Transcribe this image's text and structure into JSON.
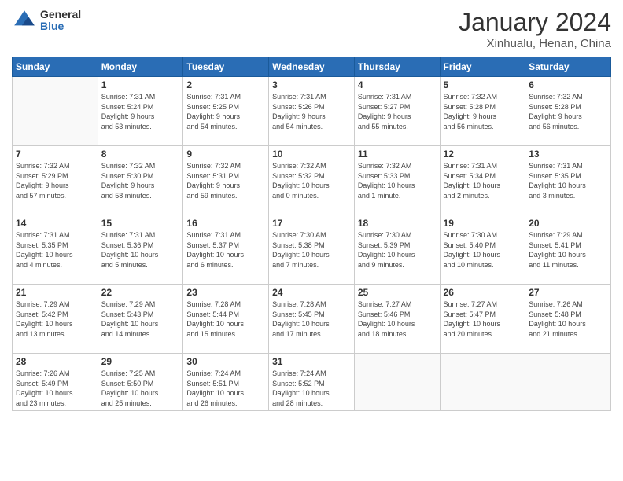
{
  "logo": {
    "general": "General",
    "blue": "Blue"
  },
  "title": "January 2024",
  "subtitle": "Xinhualu, Henan, China",
  "days_header": [
    "Sunday",
    "Monday",
    "Tuesday",
    "Wednesday",
    "Thursday",
    "Friday",
    "Saturday"
  ],
  "weeks": [
    [
      {
        "num": "",
        "info": ""
      },
      {
        "num": "1",
        "info": "Sunrise: 7:31 AM\nSunset: 5:24 PM\nDaylight: 9 hours\nand 53 minutes."
      },
      {
        "num": "2",
        "info": "Sunrise: 7:31 AM\nSunset: 5:25 PM\nDaylight: 9 hours\nand 54 minutes."
      },
      {
        "num": "3",
        "info": "Sunrise: 7:31 AM\nSunset: 5:26 PM\nDaylight: 9 hours\nand 54 minutes."
      },
      {
        "num": "4",
        "info": "Sunrise: 7:31 AM\nSunset: 5:27 PM\nDaylight: 9 hours\nand 55 minutes."
      },
      {
        "num": "5",
        "info": "Sunrise: 7:32 AM\nSunset: 5:28 PM\nDaylight: 9 hours\nand 56 minutes."
      },
      {
        "num": "6",
        "info": "Sunrise: 7:32 AM\nSunset: 5:28 PM\nDaylight: 9 hours\nand 56 minutes."
      }
    ],
    [
      {
        "num": "7",
        "info": "Sunrise: 7:32 AM\nSunset: 5:29 PM\nDaylight: 9 hours\nand 57 minutes."
      },
      {
        "num": "8",
        "info": "Sunrise: 7:32 AM\nSunset: 5:30 PM\nDaylight: 9 hours\nand 58 minutes."
      },
      {
        "num": "9",
        "info": "Sunrise: 7:32 AM\nSunset: 5:31 PM\nDaylight: 9 hours\nand 59 minutes."
      },
      {
        "num": "10",
        "info": "Sunrise: 7:32 AM\nSunset: 5:32 PM\nDaylight: 10 hours\nand 0 minutes."
      },
      {
        "num": "11",
        "info": "Sunrise: 7:32 AM\nSunset: 5:33 PM\nDaylight: 10 hours\nand 1 minute."
      },
      {
        "num": "12",
        "info": "Sunrise: 7:31 AM\nSunset: 5:34 PM\nDaylight: 10 hours\nand 2 minutes."
      },
      {
        "num": "13",
        "info": "Sunrise: 7:31 AM\nSunset: 5:35 PM\nDaylight: 10 hours\nand 3 minutes."
      }
    ],
    [
      {
        "num": "14",
        "info": "Sunrise: 7:31 AM\nSunset: 5:35 PM\nDaylight: 10 hours\nand 4 minutes."
      },
      {
        "num": "15",
        "info": "Sunrise: 7:31 AM\nSunset: 5:36 PM\nDaylight: 10 hours\nand 5 minutes."
      },
      {
        "num": "16",
        "info": "Sunrise: 7:31 AM\nSunset: 5:37 PM\nDaylight: 10 hours\nand 6 minutes."
      },
      {
        "num": "17",
        "info": "Sunrise: 7:30 AM\nSunset: 5:38 PM\nDaylight: 10 hours\nand 7 minutes."
      },
      {
        "num": "18",
        "info": "Sunrise: 7:30 AM\nSunset: 5:39 PM\nDaylight: 10 hours\nand 9 minutes."
      },
      {
        "num": "19",
        "info": "Sunrise: 7:30 AM\nSunset: 5:40 PM\nDaylight: 10 hours\nand 10 minutes."
      },
      {
        "num": "20",
        "info": "Sunrise: 7:29 AM\nSunset: 5:41 PM\nDaylight: 10 hours\nand 11 minutes."
      }
    ],
    [
      {
        "num": "21",
        "info": "Sunrise: 7:29 AM\nSunset: 5:42 PM\nDaylight: 10 hours\nand 13 minutes."
      },
      {
        "num": "22",
        "info": "Sunrise: 7:29 AM\nSunset: 5:43 PM\nDaylight: 10 hours\nand 14 minutes."
      },
      {
        "num": "23",
        "info": "Sunrise: 7:28 AM\nSunset: 5:44 PM\nDaylight: 10 hours\nand 15 minutes."
      },
      {
        "num": "24",
        "info": "Sunrise: 7:28 AM\nSunset: 5:45 PM\nDaylight: 10 hours\nand 17 minutes."
      },
      {
        "num": "25",
        "info": "Sunrise: 7:27 AM\nSunset: 5:46 PM\nDaylight: 10 hours\nand 18 minutes."
      },
      {
        "num": "26",
        "info": "Sunrise: 7:27 AM\nSunset: 5:47 PM\nDaylight: 10 hours\nand 20 minutes."
      },
      {
        "num": "27",
        "info": "Sunrise: 7:26 AM\nSunset: 5:48 PM\nDaylight: 10 hours\nand 21 minutes."
      }
    ],
    [
      {
        "num": "28",
        "info": "Sunrise: 7:26 AM\nSunset: 5:49 PM\nDaylight: 10 hours\nand 23 minutes."
      },
      {
        "num": "29",
        "info": "Sunrise: 7:25 AM\nSunset: 5:50 PM\nDaylight: 10 hours\nand 25 minutes."
      },
      {
        "num": "30",
        "info": "Sunrise: 7:24 AM\nSunset: 5:51 PM\nDaylight: 10 hours\nand 26 minutes."
      },
      {
        "num": "31",
        "info": "Sunrise: 7:24 AM\nSunset: 5:52 PM\nDaylight: 10 hours\nand 28 minutes."
      },
      {
        "num": "",
        "info": ""
      },
      {
        "num": "",
        "info": ""
      },
      {
        "num": "",
        "info": ""
      }
    ]
  ]
}
